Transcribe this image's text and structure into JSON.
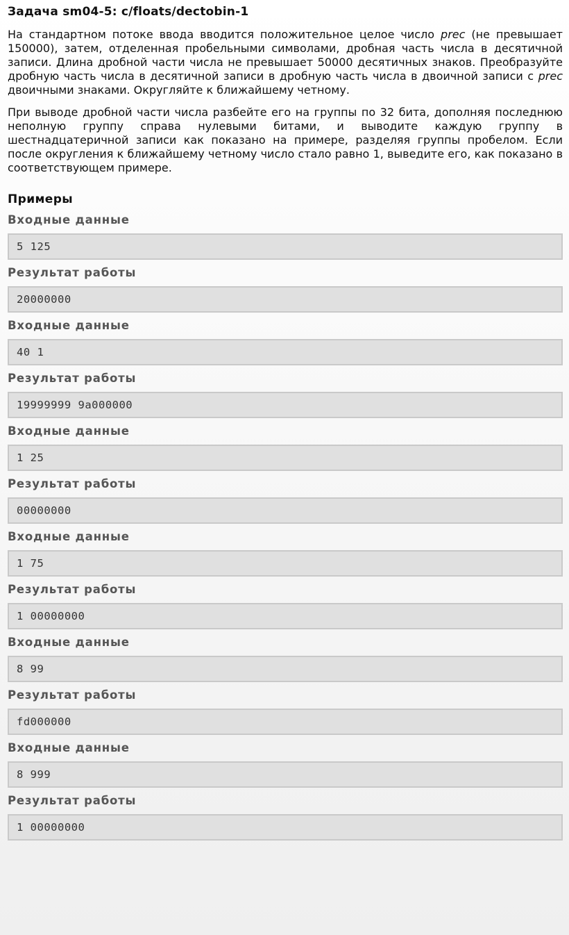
{
  "title": "Задача sm04-5: c/floats/dectobin-1",
  "statement": {
    "p1": [
      {
        "text": "На стандартном потоке ввода вводится положительное целое число "
      },
      {
        "text": "prec",
        "italic": true
      },
      {
        "text": " (не превышает 150000), затем, отделенная пробельными символами, дробная часть числа в десятичной записи. Длина дробной части числа не превышает 50000 десятичных знаков. Преобразуйте дробную часть числа в десятичной записи в дробную часть числа в двоичной записи с "
      },
      {
        "text": "prec",
        "italic": true
      },
      {
        "text": " двоичными знаками. Округляйте к ближайшему четному."
      }
    ],
    "p2": "При выводе дробной части числа разбейте его на группы по 32 бита, дополняя последнюю неполную группу справа нулевыми битами, и выводите каждую группу в шестнадцатеричной записи как показано на примере, разделяя группы пробелом. Если после округления к ближайшему четному число стало равно 1, выведите его, как показано в соответствующем примере."
  },
  "examples": {
    "heading": "Примеры",
    "input_label": "Входные данные",
    "output_label": "Результат работы",
    "items": [
      {
        "input": "5 125",
        "output": "20000000"
      },
      {
        "input": "40 1",
        "output": "19999999 9a000000"
      },
      {
        "input": "1 25",
        "output": "00000000"
      },
      {
        "input": "1 75",
        "output": "1 00000000"
      },
      {
        "input": "8 99",
        "output": "fd000000"
      },
      {
        "input": "8 999",
        "output": "1 00000000"
      }
    ]
  }
}
